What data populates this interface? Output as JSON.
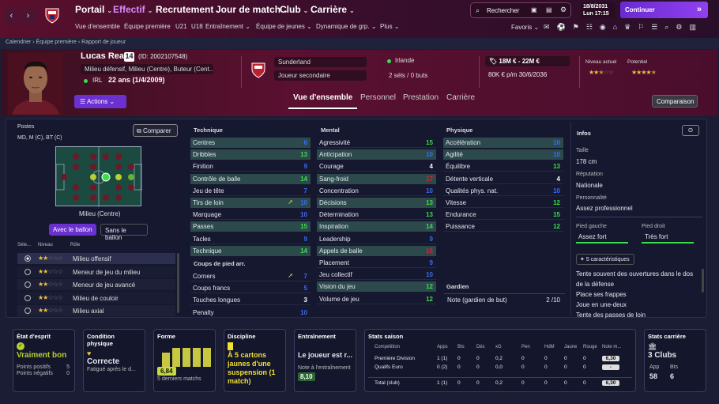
{
  "nav": {
    "main": [
      "Portail",
      "Effectif",
      "Recrutement",
      "Jour de match",
      "Club",
      "Carrière"
    ],
    "sub": [
      "Vue d'ensemble",
      "Équipe première",
      "U21",
      "U18",
      "Entraînement",
      "Équipe de jeunes",
      "Dynamique de grp.",
      "Plus"
    ],
    "search": "Rechercher",
    "date": "18/8/2031",
    "day_time": "Lun  17:15",
    "continue": "Continuer",
    "favoris": "Favoris",
    "active": "Effectif"
  },
  "breadcrumb": [
    "Calendrier",
    "Équipe première",
    "Rapport de joueur"
  ],
  "player": {
    "name": "Lucas Read",
    "number": "14",
    "id": "(ID: 2002107548)",
    "positions": "Milieu défensif, Milieu (Centre), Buteur (Cent...",
    "nation_code": "IRL",
    "age": "22 ans (1/4/2009)",
    "club": "Sunderland",
    "role": "Joueur secondaire",
    "nationality": "Irlande",
    "caps": "2 séls / 0 buts",
    "value": "18M € - 22M €",
    "wage": "80K € p/m 30/6/2036",
    "current_level_label": "Niveau actuel",
    "potential_label": "Potentiel",
    "current_stars": 2.5,
    "potential_stars": 4.5,
    "actions": "Actions"
  },
  "tabs": [
    "Vue d'ensemble",
    "Personnel",
    "Prestation",
    "Carrière"
  ],
  "comparison": "Comparaison",
  "positions_panel": {
    "title": "Postes",
    "list": "MD, M (C), BT (C)",
    "compare": "Comparer",
    "selected_position": "Milieu (Centre)",
    "with_ball": "Avec le ballon",
    "without_ball": "Sans le ballon",
    "col_sel": "Séle...",
    "col_level": "Niveau",
    "col_role": "Rôle",
    "roles": [
      {
        "name": "Milieu offensif",
        "stars": 2,
        "selected": true
      },
      {
        "name": "Meneur de jeu du milieu",
        "stars": 2,
        "selected": false
      },
      {
        "name": "Meneur de jeu avancé",
        "stars": 2,
        "selected": false
      },
      {
        "name": "Milieu de couloir",
        "stars": 2,
        "selected": false
      },
      {
        "name": "Milieu axial",
        "stars": 2,
        "selected": false
      }
    ]
  },
  "technique": {
    "title": "Technique",
    "attrs": [
      {
        "n": "Centres",
        "v": "6",
        "c": "b",
        "hl": true
      },
      {
        "n": "Dribbles",
        "v": "13",
        "c": "g",
        "hl": true
      },
      {
        "n": "Finition",
        "v": "9",
        "c": "b",
        "hl": false
      },
      {
        "n": "Contrôle de balle",
        "v": "14",
        "c": "g",
        "hl": true
      },
      {
        "n": "Jeu de tête",
        "v": "7",
        "c": "b",
        "hl": false
      },
      {
        "n": "Tirs de loin",
        "v": "10",
        "c": "b",
        "hl": true
      },
      {
        "n": "Marquage",
        "v": "10",
        "c": "b",
        "hl": false
      },
      {
        "n": "Passes",
        "v": "15",
        "c": "g",
        "hl": true
      },
      {
        "n": "Tacles",
        "v": "9",
        "c": "b",
        "hl": false
      },
      {
        "n": "Technique",
        "v": "14",
        "c": "g",
        "hl": true
      }
    ]
  },
  "set_pieces": {
    "title": "Coups de pied arr.",
    "attrs": [
      {
        "n": "Corners",
        "v": "7",
        "c": "b",
        "hl": false
      },
      {
        "n": "Coups francs",
        "v": "5",
        "c": "b",
        "hl": false
      },
      {
        "n": "Touches longues",
        "v": "3",
        "c": "w",
        "hl": false
      },
      {
        "n": "Penalty",
        "v": "10",
        "c": "b",
        "hl": false
      }
    ]
  },
  "mental": {
    "title": "Mental",
    "attrs": [
      {
        "n": "Agressivité",
        "v": "15",
        "c": "g",
        "hl": false
      },
      {
        "n": "Anticipation",
        "v": "10",
        "c": "b",
        "hl": true
      },
      {
        "n": "Courage",
        "v": "4",
        "c": "w",
        "hl": false
      },
      {
        "n": "Sang-froid",
        "v": "17",
        "c": "r",
        "hl": true
      },
      {
        "n": "Concentration",
        "v": "10",
        "c": "b",
        "hl": false
      },
      {
        "n": "Décisions",
        "v": "13",
        "c": "g",
        "hl": true
      },
      {
        "n": "Détermination",
        "v": "13",
        "c": "g",
        "hl": false
      },
      {
        "n": "Inspiration",
        "v": "14",
        "c": "g",
        "hl": true
      },
      {
        "n": "Leadership",
        "v": "9",
        "c": "b",
        "hl": false
      },
      {
        "n": "Appels de balle",
        "v": "16",
        "c": "r",
        "hl": true
      },
      {
        "n": "Placement",
        "v": "9",
        "c": "b",
        "hl": false
      },
      {
        "n": "Jeu collectif",
        "v": "10",
        "c": "b",
        "hl": false
      },
      {
        "n": "Vision du jeu",
        "v": "12",
        "c": "g",
        "hl": true
      },
      {
        "n": "Volume de jeu",
        "v": "12",
        "c": "g",
        "hl": false
      }
    ]
  },
  "physique": {
    "title": "Physique",
    "attrs": [
      {
        "n": "Accélération",
        "v": "10",
        "c": "b",
        "hl": true
      },
      {
        "n": "Agilité",
        "v": "10",
        "c": "b",
        "hl": true
      },
      {
        "n": "Équilibre",
        "v": "13",
        "c": "g",
        "hl": false
      },
      {
        "n": "Détente verticale",
        "v": "4",
        "c": "w",
        "hl": false
      },
      {
        "n": "Qualités phys. nat.",
        "v": "10",
        "c": "b",
        "hl": false
      },
      {
        "n": "Vitesse",
        "v": "12",
        "c": "g",
        "hl": false
      },
      {
        "n": "Endurance",
        "v": "15",
        "c": "g",
        "hl": false
      },
      {
        "n": "Puissance",
        "v": "12",
        "c": "g",
        "hl": false
      }
    ]
  },
  "goalkeeper": {
    "title": "Gardien",
    "label": "Note (gardien de but)",
    "value": "2 /10"
  },
  "info": {
    "title": "Infos",
    "height_label": "Taille",
    "height": "178 cm",
    "reputation_label": "Réputation",
    "reputation": "Nationale",
    "personality_label": "Personnalité",
    "personality": "Assez professionnel",
    "left_foot_label": "Pied gauche",
    "left_foot": "Assez fort",
    "right_foot_label": "Pied droit",
    "right_foot": "Très fort",
    "traits_btn": "5 caractéristiques",
    "traits": [
      "Tente souvent des ouvertures dans le dos de la défense",
      "Place ses frappes",
      "Joue en une-deux",
      "Tente des passes de loin"
    ]
  },
  "cards": {
    "morale": {
      "title": "État d'esprit",
      "value": "Vraiment bon",
      "pos_label": "Points positifs",
      "pos": "5",
      "neg_label": "Points négatifs",
      "neg": "0"
    },
    "condition": {
      "title": "Condition physique",
      "value": "Correcte",
      "sub": "Fatigué après le d..."
    },
    "form": {
      "title": "Forme",
      "value": "6,84",
      "sub": "5 derniers matchs",
      "bars": [
        0.6,
        0.8,
        0.8,
        0.8,
        0.8
      ]
    },
    "discipline": {
      "title": "Discipline",
      "value": "À 5 cartons jaunes d'une suspension (1 match)"
    },
    "training": {
      "title": "Entraînement",
      "value": "Le joueur est r...",
      "note_label": "Note à l'entraînement",
      "note": "8,10"
    },
    "season": {
      "title": "Stats saison",
      "headers": [
        "Compétition",
        "Apps",
        "Bts",
        "Déc",
        "xG",
        "Pen",
        "HdM",
        "Jaune",
        "Rouge",
        "Note m..."
      ],
      "rows": [
        [
          "Première Division",
          "1 (1)",
          "0",
          "0",
          "0,2",
          "0",
          "0",
          "0",
          "0",
          "6,30"
        ],
        [
          "Qualifs Euro",
          "0 (2)",
          "0",
          "0",
          "0,0",
          "0",
          "0",
          "0",
          "0",
          "-"
        ],
        [
          "Total (club)",
          "1 (1)",
          "0",
          "0",
          "0,2",
          "0",
          "0",
          "0",
          "0",
          "6,30"
        ]
      ]
    },
    "career": {
      "title": "Stats carrière",
      "value": "3 Clubs",
      "apps_label": "App",
      "apps": "58",
      "goals_label": "Bts",
      "goals": "6"
    }
  }
}
